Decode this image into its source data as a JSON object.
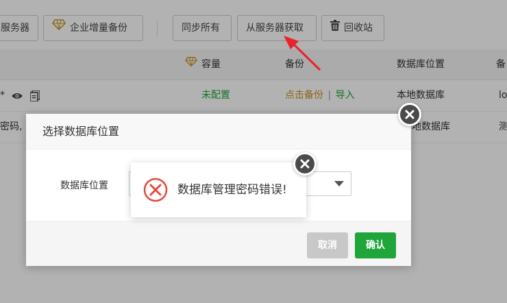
{
  "toolbar": {
    "btn_server_partial": "服务器",
    "btn_enterprise_backup": "企业增量备份",
    "btn_sync_all": "同步所有",
    "btn_fetch_from_server": "从服务器获取",
    "btn_recycle_bin": "回收站"
  },
  "table": {
    "headers": {
      "capacity": "容量",
      "backup": "备份",
      "db_location": "数据库位置",
      "note_partial": "备"
    },
    "row1": {
      "star": "*",
      "capacity": "未配置",
      "backup_link": "点击备份",
      "separator": "|",
      "import_link": "导入",
      "location": "本地数据库",
      "note_partial": "lo"
    },
    "row2": {
      "password_partial": "密码,",
      "location_partial": "地数据库",
      "note_partial": "测"
    }
  },
  "dialog": {
    "title": "选择数据库位置",
    "field_label": "数据库位置",
    "cancel_label": "取消",
    "ok_label": "确认"
  },
  "message": {
    "text": "数据库管理密码错误!"
  },
  "colors": {
    "accent_green": "#20a53a",
    "link_orange": "#c79019",
    "error_red": "#e8463b",
    "annotation_red": "#e8232a"
  }
}
